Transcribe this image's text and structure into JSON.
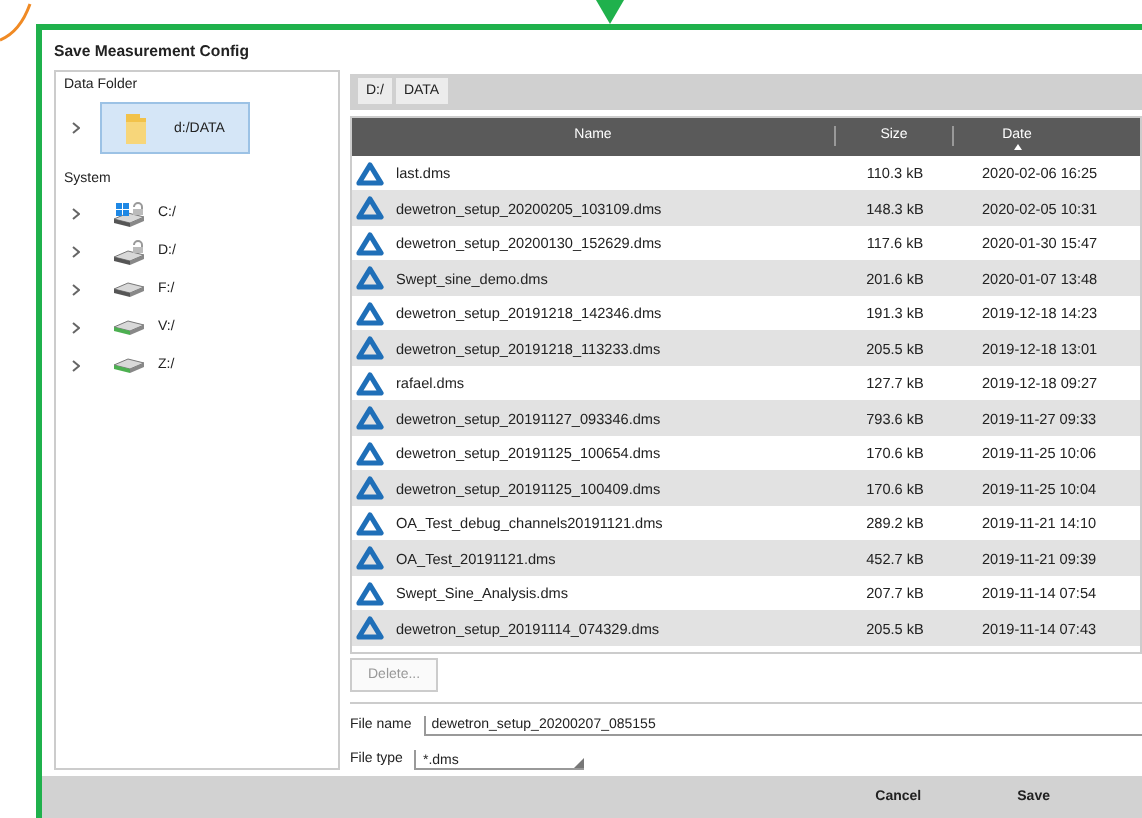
{
  "window": {
    "title": "Save Measurement Config"
  },
  "sidebar": {
    "sections": [
      {
        "title": "Data Folder",
        "items": [
          {
            "label": "d:/DATA",
            "kind": "folder",
            "selected": true
          }
        ]
      },
      {
        "title": "System",
        "items": [
          {
            "label": "C:/",
            "kind": "system",
            "selected": false
          },
          {
            "label": "D:/",
            "kind": "locked",
            "selected": false
          },
          {
            "label": "F:/",
            "kind": "plain",
            "selected": false
          },
          {
            "label": "V:/",
            "kind": "network",
            "selected": false
          },
          {
            "label": "Z:/",
            "kind": "network",
            "selected": false
          }
        ]
      }
    ]
  },
  "breadcrumb": [
    "D:/",
    "DATA"
  ],
  "table": {
    "columns": [
      {
        "label": "Name",
        "sorted": false
      },
      {
        "label": "Size",
        "sorted": false
      },
      {
        "label": "Date",
        "sorted": true
      }
    ],
    "rows": [
      {
        "name": "last.dms",
        "size": "110.3 kB",
        "date": "2020-02-06 16:25"
      },
      {
        "name": "dewetron_setup_20200205_103109.dms",
        "size": "148.3 kB",
        "date": "2020-02-05 10:31"
      },
      {
        "name": "dewetron_setup_20200130_152629.dms",
        "size": "117.6 kB",
        "date": "2020-01-30 15:47"
      },
      {
        "name": "Swept_sine_demo.dms",
        "size": "201.6 kB",
        "date": "2020-01-07 13:48"
      },
      {
        "name": "dewetron_setup_20191218_142346.dms",
        "size": "191.3 kB",
        "date": "2019-12-18 14:23"
      },
      {
        "name": "dewetron_setup_20191218_113233.dms",
        "size": "205.5 kB",
        "date": "2019-12-18 13:01"
      },
      {
        "name": "rafael.dms",
        "size": "127.7 kB",
        "date": "2019-12-18 09:27"
      },
      {
        "name": "dewetron_setup_20191127_093346.dms",
        "size": "793.6 kB",
        "date": "2019-11-27 09:33"
      },
      {
        "name": "dewetron_setup_20191125_100654.dms",
        "size": "170.6 kB",
        "date": "2019-11-25 10:06"
      },
      {
        "name": "dewetron_setup_20191125_100409.dms",
        "size": "170.6 kB",
        "date": "2019-11-25 10:04"
      },
      {
        "name": "OA_Test_debug_channels20191121.dms",
        "size": "289.2 kB",
        "date": "2019-11-21 14:10"
      },
      {
        "name": "OA_Test_20191121.dms",
        "size": "452.7 kB",
        "date": "2019-11-21 09:39"
      },
      {
        "name": "Swept_Sine_Analysis.dms",
        "size": "207.7 kB",
        "date": "2019-11-14 07:54"
      },
      {
        "name": "dewetron_setup_20191114_074329.dms",
        "size": "205.5 kB",
        "date": "2019-11-14 07:43"
      }
    ]
  },
  "delete_button": {
    "label": "Delete...",
    "disabled": true
  },
  "file_name": {
    "label": "File name",
    "value": "dewetron_setup_20200207_085155"
  },
  "file_type": {
    "label": "File type",
    "value": "*.dms"
  },
  "buttons": [
    "Cancel",
    "Save"
  ]
}
